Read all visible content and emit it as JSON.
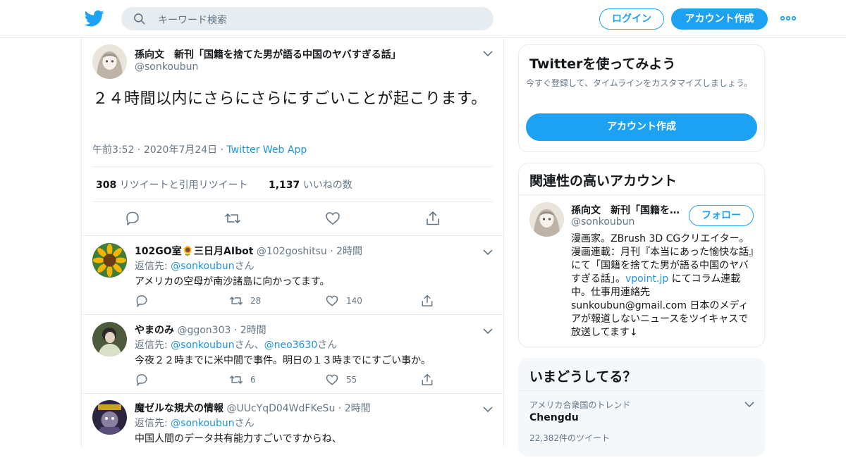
{
  "header": {
    "search_placeholder": "キーワード検索",
    "login_label": "ログイン",
    "signup_label": "アカウント作成"
  },
  "colors": {
    "accent": "#1da1f2",
    "link": "#1b95e0",
    "muted": "#657786",
    "border": "#e6ecf0"
  },
  "main_tweet": {
    "name": "孫向文　新刊「国籍を捨てた男が語る中国のヤバすぎる話」",
    "handle": "@sonkoubun",
    "text": "２４時間以内にさらにさらにすごいことが起こります。",
    "time": "午前3:52",
    "date": "2020年7月24日",
    "source": "Twitter Web App",
    "retweets": "308",
    "retweets_label": "リツイートと引用リツイート",
    "likes": "1,137",
    "likes_label": "いいねの数"
  },
  "replies": [
    {
      "name": "102GO室🌻三日月AIbot",
      "handle": "@102goshitsu",
      "time": "2時間",
      "reply_prefix": "返信先: ",
      "reply_to": "@sonkoubun",
      "reply_suffix": "さん",
      "reply_to2": "",
      "reply_suffix2": "",
      "text": "アメリカの空母が南沙諸島に向かってます。",
      "retweets": "28",
      "likes": "140"
    },
    {
      "name": "やまのみ",
      "handle": "@ggon303",
      "time": "2時間",
      "reply_prefix": "返信先: ",
      "reply_to": "@sonkoubun",
      "reply_suffix": "さん、",
      "reply_to2": "@neo3630",
      "reply_suffix2": "さん",
      "text": "今夜２２時までに米中間で事件。明日の１３時までにすごい事か。",
      "retweets": "6",
      "likes": "55"
    },
    {
      "name": "魔ゼルな規犬の情報",
      "handle": "@UUcYqD04WdFKeSu",
      "time": "2時間",
      "reply_prefix": "返信先: ",
      "reply_to": "@sonkoubun",
      "reply_suffix": "さん",
      "reply_to2": "",
      "reply_suffix2": "",
      "text": "中国人間のデータ共有能力すごいですからね、",
      "retweets": "",
      "likes": ""
    }
  ],
  "sidebar": {
    "try_title": "Twitterを使ってみよう",
    "try_sub": "今すぐ登録して、タイムラインをカスタマイズしましょう。",
    "try_button": "アカウント作成",
    "related_title": "関連性の高いアカウント",
    "related_name": "孫向文　新刊「国籍を捨てた男が語る中国のヤバすぎる話」",
    "related_handle": "@sonkoubun",
    "follow_label": "フォロー",
    "bio_part1": "漫画家。ZBrush 3D CGクリエイター。漫画連載：月刊『本当にあった愉快な話』にて「国籍を捨てた男が語る中国のヤバすぎる話」。",
    "bio_link": "vpoint.jp",
    "bio_part2": " にてコラム連載中。仕事用連絡先 sunkoubun@gmail.com 日本のメディアが報道しないニュースをツイキャスで放送してます↓",
    "trends_title": "いまどうしてる？",
    "trend_context": "アメリカ合衆国のトレンド",
    "trend_name": "Chengdu",
    "trend_count": "22,382件のツイート"
  }
}
